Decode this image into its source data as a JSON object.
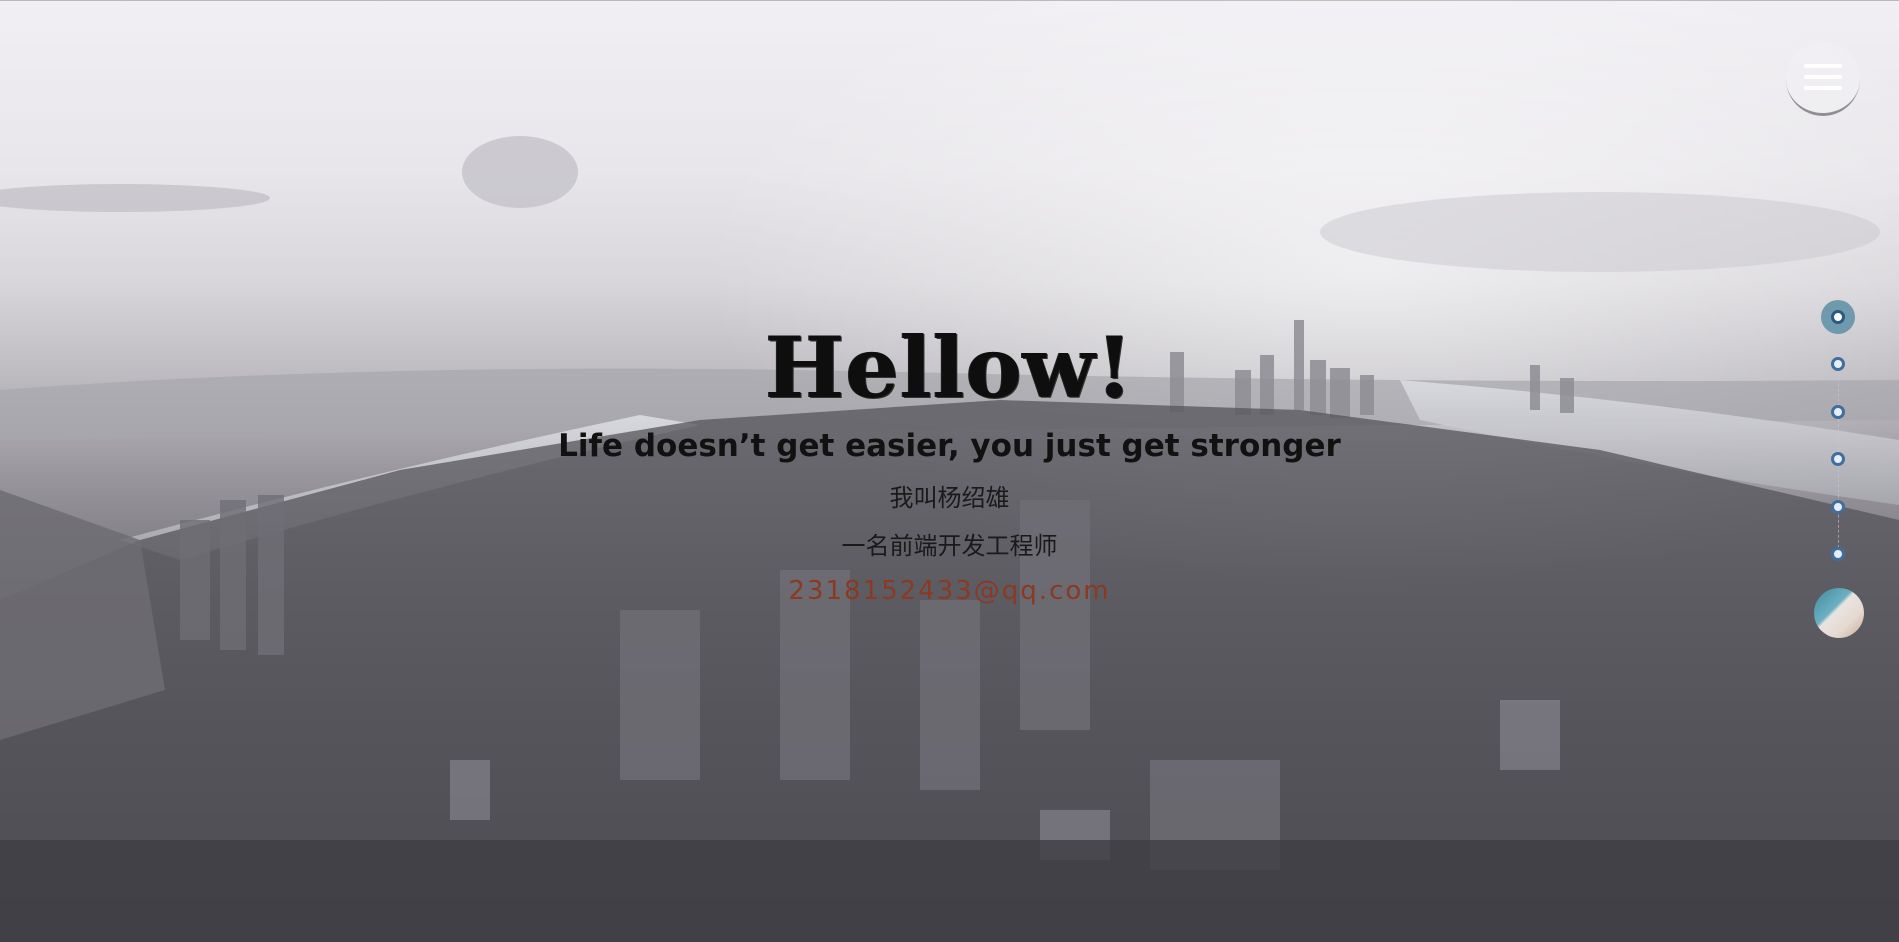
{
  "hero": {
    "title": "Hellow!",
    "motto": "Life doesn’t get easier, you just get stronger",
    "name_line": "我叫杨绍雄",
    "role_line": "一名前端开发工程师",
    "email": "2318152433@qq.com"
  },
  "menu": {
    "icon": "hamburger-menu-icon"
  },
  "section_nav": {
    "count": 6,
    "active_index": 0
  },
  "avatar": {
    "icon": "user-avatar"
  },
  "colors": {
    "email": "#8a3a22",
    "nav_dot_border": "#3f6fa0",
    "nav_active_bg": "#6f99ad"
  }
}
